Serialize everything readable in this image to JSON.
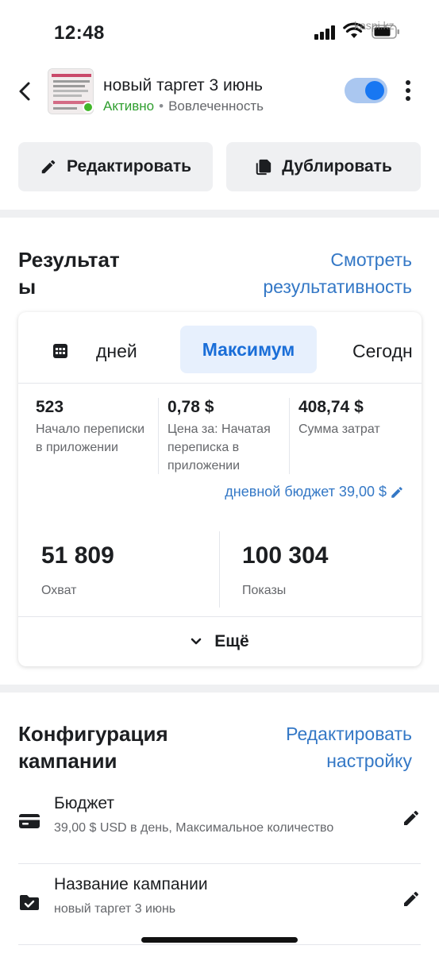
{
  "status_bar": {
    "time": "12:48",
    "watermark": "kaspi.kz"
  },
  "header": {
    "title": "новый таргет 3 июнь",
    "status": "Активно",
    "separator": "•",
    "objective": "Вовлеченность",
    "toggle_on": true,
    "accent": "#1877f2"
  },
  "actions": {
    "edit_label": "Редактировать",
    "duplicate_label": "Дублировать"
  },
  "results": {
    "title_line1": "Результат",
    "title_line2": "ы",
    "link_line1": "Смотреть",
    "link_line2": "результативность",
    "tabs": {
      "days": "дней",
      "maximum": "Максимум",
      "today": "Сегодн"
    },
    "metrics": [
      {
        "value": "523",
        "label": "Начало переписки в приложении"
      },
      {
        "value": "0,78 $",
        "label": "Цена за: Начатая переписка в приложении"
      },
      {
        "value": "408,74 $",
        "label": "Сумма затрат"
      }
    ],
    "daily_budget": "дневной бюджет 39,00 $",
    "reach": {
      "value": "51 809",
      "label": "Охват"
    },
    "impressions": {
      "value": "100 304",
      "label": "Показы"
    },
    "more_label": "Ещё"
  },
  "config": {
    "title_line1": "Конфигурация",
    "title_line2": "кампании",
    "link_line1": "Редактировать",
    "link_line2": "настройку",
    "rows": [
      {
        "icon": "credit-card-icon",
        "title": "Бюджет",
        "subtitle": "39,00 $ USD в день, Максимальное количество"
      },
      {
        "icon": "folder-check-icon",
        "title": "Название кампании",
        "subtitle": "новый таргет 3 июнь"
      }
    ]
  }
}
